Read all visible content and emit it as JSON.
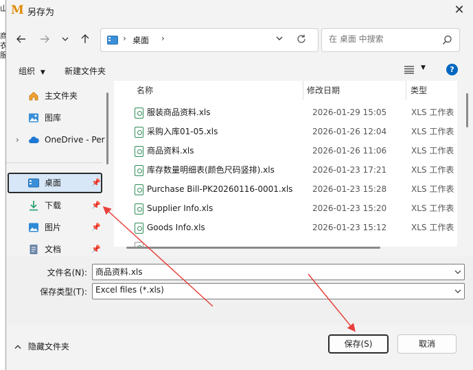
{
  "window": {
    "title": "另存为",
    "logo_letter": "M"
  },
  "background_chars": [
    "山",
    "商",
    "衣",
    "服"
  ],
  "address": {
    "location": "桌面"
  },
  "search": {
    "placeholder": "在 桌面 中搜索"
  },
  "toolbar": {
    "organize_label": "组织",
    "new_folder_label": "新建文件夹"
  },
  "nav_pane": {
    "items": [
      {
        "label": "主文件夹",
        "icon": "home-icon"
      },
      {
        "label": "图库",
        "icon": "gallery-icon"
      },
      {
        "label": "OneDrive - Per",
        "icon": "cloud-icon"
      },
      {
        "label": "桌面",
        "icon": "desktop-icon"
      },
      {
        "label": "下载",
        "icon": "download-icon"
      },
      {
        "label": "图片",
        "icon": "pictures-icon"
      },
      {
        "label": "文档",
        "icon": "documents-icon"
      }
    ]
  },
  "file_list": {
    "columns": [
      "名称",
      "修改日期",
      "类型"
    ],
    "rows": [
      {
        "name": "服装商品资料.xls",
        "date": "2026-01-29 15:05",
        "type": "XLS 工作表"
      },
      {
        "name": "采购入库01-05.xls",
        "date": "2026-01-26 12:04",
        "type": "XLS 工作表"
      },
      {
        "name": "商品资料.xls",
        "date": "2026-01-26 11:06",
        "type": "XLS 工作表"
      },
      {
        "name": "库存数量明细表(颜色尺码竖排).xls",
        "date": "2026-01-23 17:21",
        "type": "XLS 工作表"
      },
      {
        "name": "Purchase Bill-PK20260116-0001.xls",
        "date": "2026-01-23 15:28",
        "type": "XLS 工作表"
      },
      {
        "name": "Supplier Info.xls",
        "date": "2026-01-23 15:20",
        "type": "XLS 工作表"
      },
      {
        "name": "Goods Info.xls",
        "date": "2026-01-23 15:12",
        "type": "XLS 工作表"
      }
    ]
  },
  "form": {
    "filename_label": "文件名(N):",
    "filename_value": "商品资料.xls",
    "filetype_label": "保存类型(T):",
    "filetype_value": "Excel files (*.xls)"
  },
  "footer": {
    "hide_folders_label": "隐藏文件夹",
    "save_label": "保存(S)",
    "cancel_label": "取消"
  },
  "colors": {
    "accent": "#0067c0",
    "annotation_arrow": "#e8413c",
    "selection": "#d7e7f7"
  }
}
